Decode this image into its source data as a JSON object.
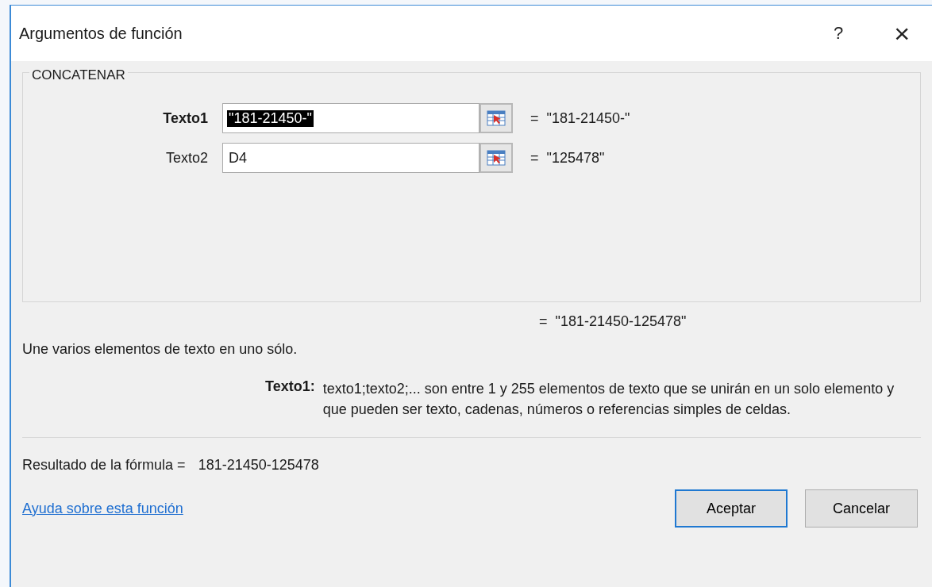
{
  "window": {
    "title": "Argumentos de función",
    "help_glyph": "?",
    "close_glyph": "×"
  },
  "function": {
    "name": "CONCATENAR",
    "arguments": [
      {
        "label": "Texto1",
        "value": "\"181-21450-\"",
        "result": "=  \"181-21450-\"",
        "active": true
      },
      {
        "label": "Texto2",
        "value": "D4",
        "result": "=  \"125478\"",
        "active": false
      }
    ],
    "result": "=  \"181-21450-125478\""
  },
  "description": "Une varios elementos de texto en uno sólo.",
  "argument_help": {
    "label": "Texto1:",
    "text": "texto1;texto2;... son entre 1 y 255 elementos de texto que se unirán en un solo elemento y que pueden ser texto, cadenas, números o referencias simples de celdas."
  },
  "formula_result": {
    "label": "Resultado de la fórmula =",
    "value": "181-21450-125478"
  },
  "help_link": "Ayuda sobre esta función",
  "buttons": [
    {
      "label": "Aceptar",
      "default": true
    },
    {
      "label": "Cancelar",
      "default": false
    }
  ]
}
